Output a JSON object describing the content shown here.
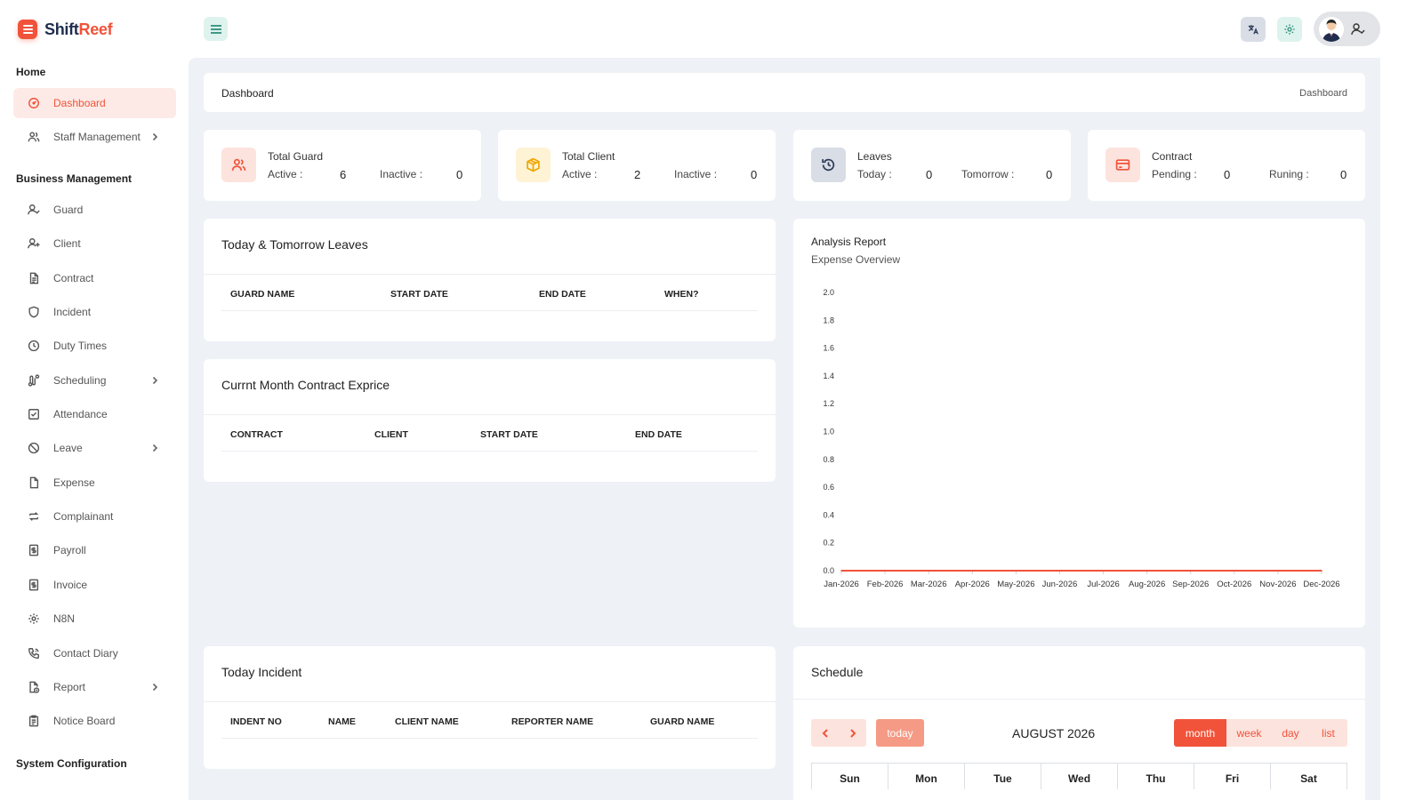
{
  "brand": {
    "part1": "Shift",
    "part2": "Reef",
    "accent": "#f0533a"
  },
  "sidebar": {
    "sections": [
      {
        "title": "Home"
      },
      {
        "title": "Business Management"
      },
      {
        "title": "System Configuration"
      }
    ],
    "items": [
      {
        "label": "Dashboard",
        "icon": "dashboard-icon",
        "active": true
      },
      {
        "label": "Staff Management",
        "icon": "users-icon",
        "chevron": true
      },
      {
        "label": "Guard",
        "icon": "user-check-icon"
      },
      {
        "label": "Client",
        "icon": "user-plus-icon"
      },
      {
        "label": "Contract",
        "icon": "file-text-icon"
      },
      {
        "label": "Incident",
        "icon": "shield-icon"
      },
      {
        "label": "Duty Times",
        "icon": "clock-icon"
      },
      {
        "label": "Scheduling",
        "icon": "route-icon",
        "chevron": true
      },
      {
        "label": "Attendance",
        "icon": "check-square-icon"
      },
      {
        "label": "Leave",
        "icon": "ban-icon",
        "chevron": true
      },
      {
        "label": "Expense",
        "icon": "file-icon"
      },
      {
        "label": "Complainant",
        "icon": "repeat-icon"
      },
      {
        "label": "Payroll",
        "icon": "receipt-icon"
      },
      {
        "label": "Invoice",
        "icon": "invoice-icon"
      },
      {
        "label": "N8N",
        "icon": "cog-icon"
      },
      {
        "label": "Contact Diary",
        "icon": "phone-icon"
      },
      {
        "label": "Report",
        "icon": "file-clock-icon",
        "chevron": true
      },
      {
        "label": "Notice Board",
        "icon": "clipboard-icon"
      }
    ]
  },
  "breadcrumb": {
    "title": "Dashboard",
    "current": "Dashboard"
  },
  "stats": [
    {
      "title": "Total Guard",
      "l1": "Active :",
      "v1": "6",
      "l2": "Inactive :",
      "v2": "0",
      "icon": "users-icon",
      "bg": "#fde3dd",
      "color": "#f0533a"
    },
    {
      "title": "Total Client",
      "l1": "Active :",
      "v1": "2",
      "l2": "Inactive :",
      "v2": "0",
      "icon": "box-icon",
      "bg": "#fef3d5",
      "color": "#f0a500"
    },
    {
      "title": "Leaves",
      "l1": "Today :",
      "v1": "0",
      "l2": "Tomorrow :",
      "v2": "0",
      "icon": "history-icon",
      "bg": "#d8dde6",
      "color": "#2b3a55"
    },
    {
      "title": "Contract",
      "l1": "Pending :",
      "v1": "0",
      "l2": "Runing :",
      "v2": "0",
      "icon": "credit-card-icon",
      "bg": "#fde3dd",
      "color": "#f0533a"
    }
  ],
  "leaves_table": {
    "title": "Today & Tomorrow Leaves",
    "headers": [
      "GUARD NAME",
      "START DATE",
      "END DATE",
      "WHEN?"
    ]
  },
  "contract_table": {
    "title": "Currnt Month Contract Exprice",
    "headers": [
      "CONTRACT",
      "CLIENT",
      "START DATE",
      "END DATE"
    ]
  },
  "incident_table": {
    "title": "Today Incident",
    "headers": [
      "INDENT NO",
      "NAME",
      "CLIENT NAME",
      "REPORTER NAME",
      "GUARD NAME"
    ]
  },
  "analysis": {
    "title": "Analysis Report",
    "subtitle": "Expense Overview"
  },
  "chart_data": {
    "type": "line",
    "title": "Analysis Report",
    "subtitle": "Expense Overview",
    "categories": [
      "Jan-2026",
      "Feb-2026",
      "Mar-2026",
      "Apr-2026",
      "May-2026",
      "Jun-2026",
      "Jul-2026",
      "Aug-2026",
      "Sep-2026",
      "Oct-2026",
      "Nov-2026",
      "Dec-2026"
    ],
    "series": [
      {
        "values": [
          0,
          0,
          0,
          0,
          0,
          0,
          0,
          0,
          0,
          0,
          0,
          0
        ],
        "color": "#f0533a"
      }
    ],
    "yticks": [
      "2.0",
      "1.8",
      "1.6",
      "1.4",
      "1.2",
      "1.0",
      "0.8",
      "0.6",
      "0.4",
      "0.2",
      "0.0"
    ],
    "ylim": [
      0,
      2
    ],
    "xlabel": "",
    "ylabel": "",
    "grid": false
  },
  "schedule": {
    "title": "Schedule",
    "today_label": "today",
    "month_label": "AUGUST 2026",
    "views": [
      "month",
      "week",
      "day",
      "list"
    ],
    "active_view": "month",
    "weekdays": [
      "Sun",
      "Mon",
      "Tue",
      "Wed",
      "Thu",
      "Fri",
      "Sat"
    ]
  }
}
